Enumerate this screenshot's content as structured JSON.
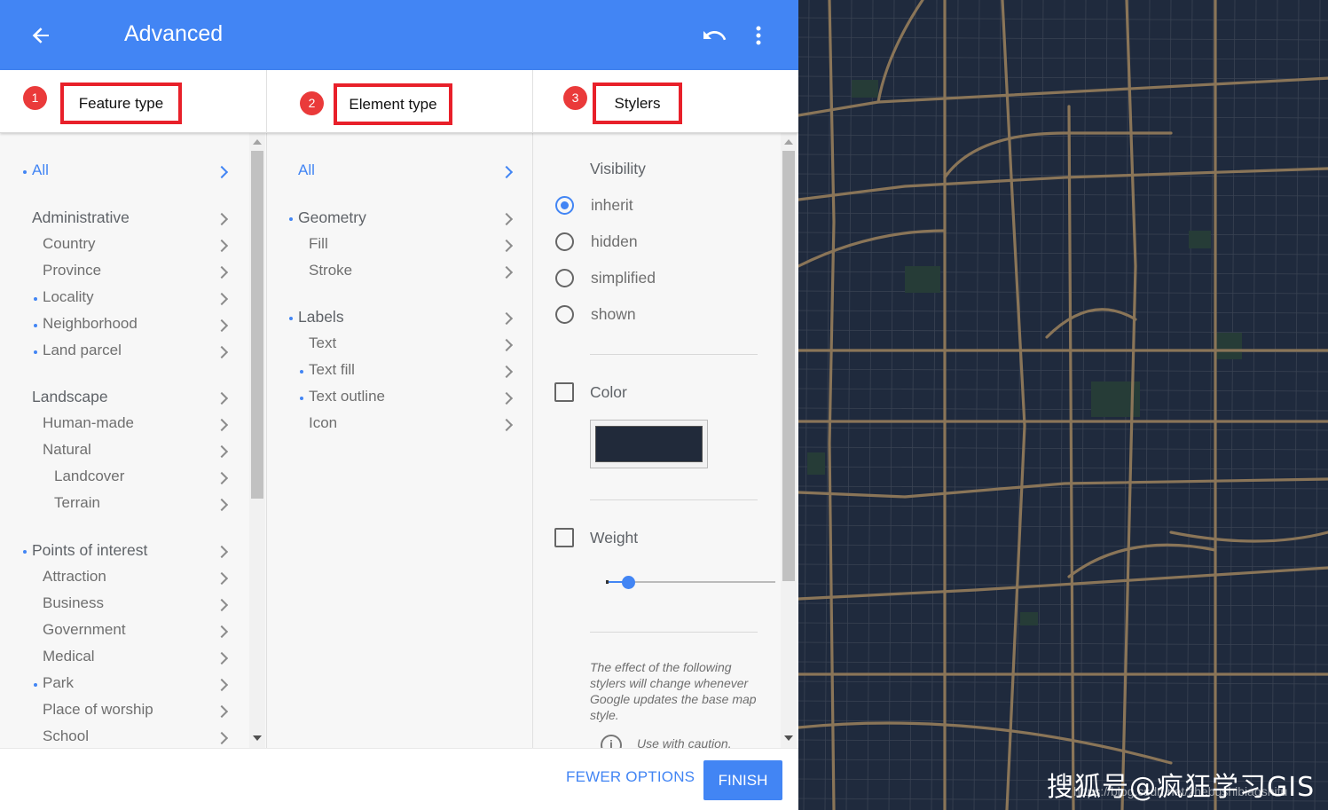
{
  "topbar": {
    "title": "Advanced",
    "back_icon": "arrow-back-icon",
    "undo_icon": "undo-icon",
    "more_icon": "more-vert-icon"
  },
  "columns": {
    "feature": {
      "number": "1",
      "label": "Feature type"
    },
    "element": {
      "number": "2",
      "label": "Element type"
    },
    "stylers": {
      "number": "3",
      "label": "Stylers"
    }
  },
  "feature_types": [
    {
      "label": "All",
      "indent": 0,
      "dot": true,
      "selected": true
    },
    {
      "label": "Administrative",
      "indent": 0,
      "heading": true
    },
    {
      "label": "Country",
      "indent": 1
    },
    {
      "label": "Province",
      "indent": 1
    },
    {
      "label": "Locality",
      "indent": 1,
      "dot": true
    },
    {
      "label": "Neighborhood",
      "indent": 1,
      "dot": true
    },
    {
      "label": "Land parcel",
      "indent": 1,
      "dot": true
    },
    {
      "label": "Landscape",
      "indent": 0,
      "heading": true
    },
    {
      "label": "Human-made",
      "indent": 1
    },
    {
      "label": "Natural",
      "indent": 1
    },
    {
      "label": "Landcover",
      "indent": 2
    },
    {
      "label": "Terrain",
      "indent": 2
    },
    {
      "label": "Points of interest",
      "indent": 0,
      "heading": true,
      "dot": true
    },
    {
      "label": "Attraction",
      "indent": 1
    },
    {
      "label": "Business",
      "indent": 1
    },
    {
      "label": "Government",
      "indent": 1
    },
    {
      "label": "Medical",
      "indent": 1
    },
    {
      "label": "Park",
      "indent": 1,
      "dot": true
    },
    {
      "label": "Place of worship",
      "indent": 1
    },
    {
      "label": "School",
      "indent": 1
    }
  ],
  "element_types": [
    {
      "label": "All",
      "indent": 0,
      "selected": true
    },
    {
      "label": "Geometry",
      "indent": 0,
      "heading": true,
      "dot": true
    },
    {
      "label": "Fill",
      "indent": 1
    },
    {
      "label": "Stroke",
      "indent": 1
    },
    {
      "label": "Labels",
      "indent": 0,
      "heading": true,
      "dot": true
    },
    {
      "label": "Text",
      "indent": 1
    },
    {
      "label": "Text fill",
      "indent": 1,
      "dot": true
    },
    {
      "label": "Text outline",
      "indent": 1,
      "dot": true
    },
    {
      "label": "Icon",
      "indent": 1
    }
  ],
  "stylers": {
    "visibility_label": "Visibility",
    "options": [
      "inherit",
      "hidden",
      "simplified",
      "shown"
    ],
    "selected_option": "inherit",
    "color_label": "Color",
    "color_value": "#212a3a",
    "weight_label": "Weight",
    "weight_value": 0.12,
    "note": "The effect of the following stylers will change whenever Google updates the base map style.",
    "caution": "Use with caution."
  },
  "footer": {
    "fewer_label": "FEWER OPTIONS",
    "finish_label": "FINISH"
  },
  "watermark": {
    "text": "搜狐号@疯狂学习GIS",
    "sub": "https://blog.csdn.net/zhebushibiaoshifu"
  },
  "colors": {
    "accent": "#4285f4",
    "badge": "#ea3a3a",
    "map_bg": "#1f2a3d",
    "road": "#8a7558"
  }
}
